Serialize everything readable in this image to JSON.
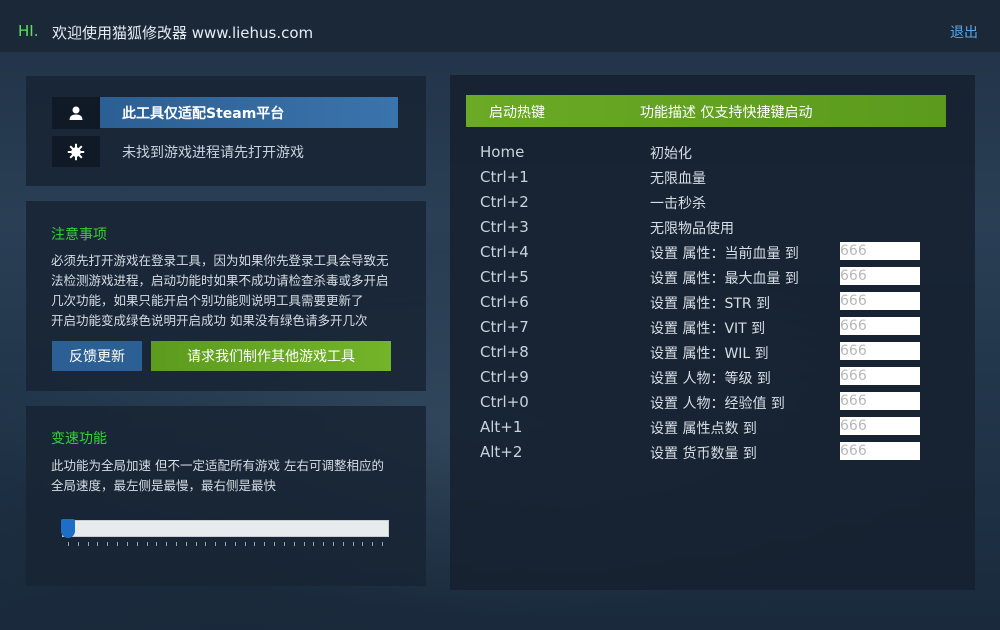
{
  "titlebar": {
    "hi": "HI.",
    "title": "欢迎使用猫狐修改器 www.liehus.com",
    "exit": "退出"
  },
  "platform": {
    "user_icon": "user-icon",
    "gear_icon": "gear-icon",
    "label": "此工具仅适配Steam平台",
    "status": "未找到游戏进程请先打开游戏"
  },
  "notes": {
    "title": "注意事项",
    "lines": [
      "必须先打开游戏在登录工具，因为如果你先登录工具会导致无",
      "法检测游戏进程，启动功能时如果不成功请检查杀毒或多开启",
      "几次功能，如果只能开启个别功能则说明工具需要更新了",
      "开启功能变成绿色说明开启成功 如果没有绿色请多开几次"
    ],
    "feedback_button": "反馈更新",
    "request_button": "请求我们制作其他游戏工具"
  },
  "speed": {
    "title": "变速功能",
    "lines": [
      "此功能为全局加速 但不一定适配所有游戏 左右可调整相应的",
      "全局速度，最左侧是最慢，最右侧是最快"
    ],
    "slider_value_fraction": 0.0
  },
  "hotkeys": {
    "header_col1": "启动热键",
    "header_col2": "功能描述 仅支持快捷键启动",
    "rows": [
      {
        "key": "Home",
        "desc": "初始化"
      },
      {
        "key": "Ctrl+1",
        "desc": "无限血量"
      },
      {
        "key": "Ctrl+2",
        "desc": "一击秒杀"
      },
      {
        "key": "Ctrl+3",
        "desc": "无限物品使用"
      },
      {
        "key": "Ctrl+4",
        "desc": "设置 属性：当前血量 到",
        "placeholder": "666"
      },
      {
        "key": "Ctrl+5",
        "desc": "设置 属性：最大血量 到",
        "placeholder": "666"
      },
      {
        "key": "Ctrl+6",
        "desc": "设置 属性：STR 到",
        "placeholder": "666"
      },
      {
        "key": "Ctrl+7",
        "desc": "设置 属性：VIT 到",
        "placeholder": "666"
      },
      {
        "key": "Ctrl+8",
        "desc": "设置 属性：WIL 到",
        "placeholder": "666"
      },
      {
        "key": "Ctrl+9",
        "desc": "设置 人物：等级 到",
        "placeholder": "666"
      },
      {
        "key": "Ctrl+0",
        "desc": "设置 人物：经验值 到",
        "placeholder": "666"
      },
      {
        "key": "Alt+1",
        "desc": "设置 属性点数 到",
        "placeholder": "666"
      },
      {
        "key": "Alt+2",
        "desc": "设置 货币数量 到",
        "placeholder": "666"
      }
    ]
  },
  "colors": {
    "accent_green": "#6aaa25",
    "accent_blue": "#2c5f93",
    "title_green": "#35d035",
    "link_blue": "#5aa6e6"
  }
}
